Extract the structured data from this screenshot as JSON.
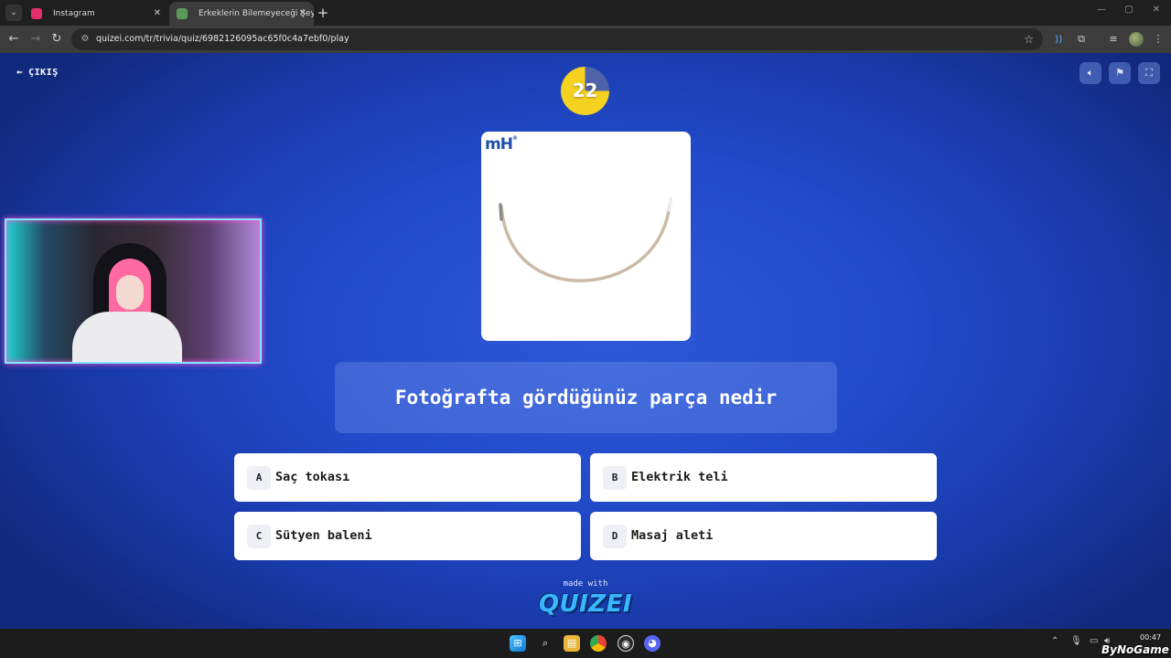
{
  "browser": {
    "tabs": [
      {
        "title": "Instagram",
        "favicon_color": "#e1306c"
      },
      {
        "title": "Erkeklerin Bilemeyeceği Şeyler",
        "favicon_color": "#5a9b5a"
      }
    ],
    "url": "quizei.com/tr/trivia/quiz/6982126095ac65f0c4a7ebf0/play"
  },
  "quiz": {
    "exit_label": "ÇIKIŞ",
    "timer": 22,
    "brand_logo": "mH",
    "question": "Fotoğrafta gördüğünüz parça nedir",
    "answers": [
      {
        "letter": "A",
        "text": "Saç tokası"
      },
      {
        "letter": "B",
        "text": "Elektrik teli"
      },
      {
        "letter": "C",
        "text": "Sütyen baleni"
      },
      {
        "letter": "D",
        "text": "Masaj aleti"
      }
    ],
    "made_with": "made with",
    "logo_text": "QUIZEI"
  },
  "taskbar": {
    "clock": "00:47"
  },
  "watermark": "ByNoGame",
  "colors": {
    "accent_yellow": "#f5d21f",
    "page_blue": "#2149c8",
    "logo_blue": "#38b6ff"
  }
}
